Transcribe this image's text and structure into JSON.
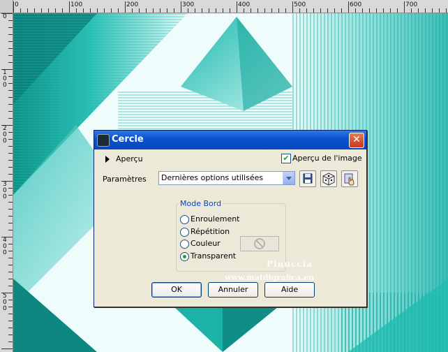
{
  "ruler": {
    "top_labels": [
      "0",
      "100",
      "200",
      "300",
      "400",
      "500",
      "600",
      "700"
    ],
    "left_labels": [
      "0",
      "1\n0\n0",
      "2\n0\n0",
      "3\n0\n0",
      "4\n0\n0",
      "5\n0\n0"
    ]
  },
  "dialog": {
    "title": "Cercle",
    "close_symbol": "✕",
    "preview_label": "Aperçu",
    "image_preview_label": "Aperçu de l'image",
    "image_preview_checked": true,
    "params_label": "Paramètres",
    "params_value": "Dernières options utilisées",
    "group_label": "Mode Bord",
    "options": [
      {
        "label": "Enroulement",
        "checked": false
      },
      {
        "label": "Répétition",
        "checked": false
      },
      {
        "label": "Couleur",
        "checked": false
      },
      {
        "label": "Transparent",
        "checked": true
      }
    ],
    "buttons": {
      "ok": "OK",
      "cancel": "Annuler",
      "help": "Aide"
    },
    "icons": [
      "save-icon",
      "dice-icon",
      "hand-edit-icon",
      "no-color-icon"
    ]
  },
  "watermark": {
    "line1": "Pinuccia",
    "line2": "www.matdigrafica.eu"
  },
  "colors": {
    "accent_teal": "#1fb9ae",
    "titlebar": "#0b53d0",
    "close": "#c8371c"
  }
}
